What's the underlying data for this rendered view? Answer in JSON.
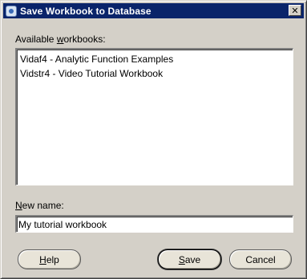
{
  "window": {
    "title": "Save Workbook to Database",
    "close_glyph": "✕"
  },
  "available": {
    "label_pre": "Available ",
    "label_accel": "w",
    "label_post": "orkbooks:",
    "items": [
      "Vidaf4 - Analytic Function Examples",
      "Vidstr4 - Video Tutorial Workbook"
    ]
  },
  "new_name": {
    "label_accel": "N",
    "label_post": "ew name:",
    "value": "My tutorial workbook"
  },
  "buttons": {
    "help_accel": "H",
    "help_post": "elp",
    "save_accel": "S",
    "save_post": "ave",
    "cancel_label": "Cancel"
  },
  "icons": {
    "title_icon": "database-app-icon",
    "close_icon": "close-icon"
  }
}
